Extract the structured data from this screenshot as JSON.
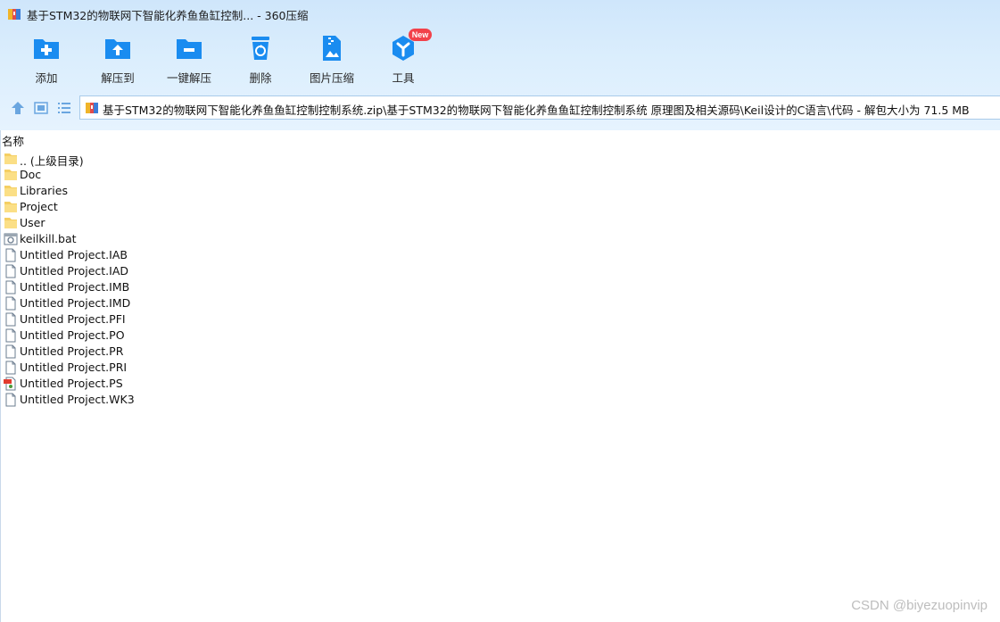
{
  "window": {
    "title": "基于STM32的物联网下智能化养鱼鱼缸控制... - 360压缩"
  },
  "toolbar": {
    "items": [
      {
        "label": "添加",
        "icon": "add-folder-icon"
      },
      {
        "label": "解压到",
        "icon": "extract-to-icon"
      },
      {
        "label": "一键解压",
        "icon": "one-click-extract-icon"
      },
      {
        "label": "删除",
        "icon": "recycle-bin-icon"
      },
      {
        "label": "图片压缩",
        "icon": "image-compress-icon"
      },
      {
        "label": "工具",
        "icon": "tools-icon",
        "badge": "New"
      }
    ]
  },
  "navigation": {
    "up_icon": "arrow-up-icon",
    "view_icon": "thumbnail-view-icon",
    "list_icon": "list-view-icon"
  },
  "address": {
    "path": "基于STM32的物联网下智能化养鱼鱼缸控制控制系统.zip\\基于STM32的物联网下智能化养鱼鱼缸控制控制系统 原理图及相关源码\\Keil设计的C语言\\代码 - 解包大小为 71.5 MB"
  },
  "file_list": {
    "column_name": "名称",
    "rows": [
      {
        "name": ".. (上级目录)",
        "type": "folder"
      },
      {
        "name": "Doc",
        "type": "folder"
      },
      {
        "name": "Libraries",
        "type": "folder"
      },
      {
        "name": "Project",
        "type": "folder"
      },
      {
        "name": "User",
        "type": "folder"
      },
      {
        "name": "keilkill.bat",
        "type": "batch"
      },
      {
        "name": "Untitled Project.IAB",
        "type": "file"
      },
      {
        "name": "Untitled Project.IAD",
        "type": "file"
      },
      {
        "name": "Untitled Project.IMB",
        "type": "file"
      },
      {
        "name": "Untitled Project.IMD",
        "type": "file"
      },
      {
        "name": "Untitled Project.PFI",
        "type": "file"
      },
      {
        "name": "Untitled Project.PO",
        "type": "file"
      },
      {
        "name": "Untitled Project.PR",
        "type": "file"
      },
      {
        "name": "Untitled Project.PRI",
        "type": "file"
      },
      {
        "name": "Untitled Project.PS",
        "type": "ps"
      },
      {
        "name": "Untitled Project.WK3",
        "type": "file"
      }
    ]
  },
  "watermark": "CSDN @biyezuopinvip",
  "colors": {
    "accent": "#1a8cf0",
    "folder": "#f5cf63",
    "badge": "#f2414a"
  }
}
